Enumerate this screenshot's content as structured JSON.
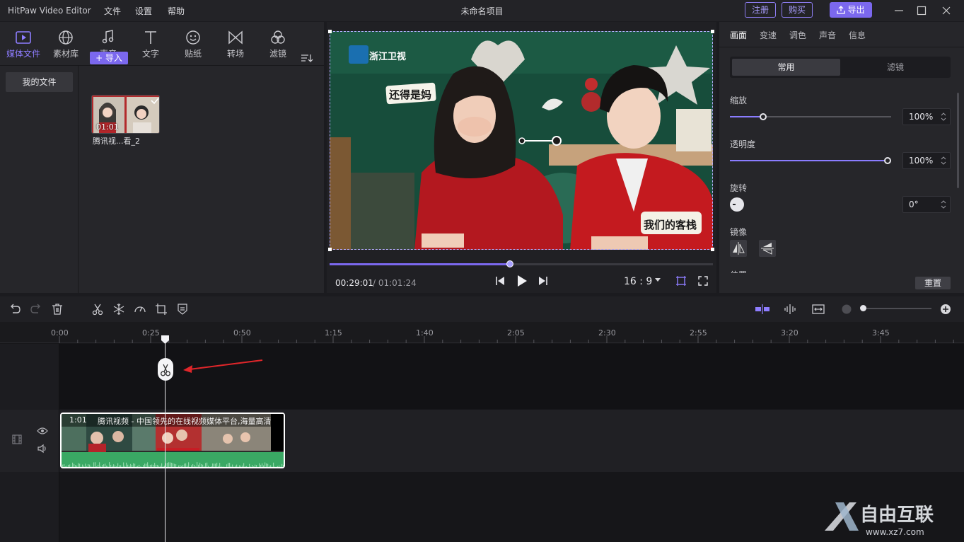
{
  "app": {
    "name": "HitPaw Video Editor",
    "menu": [
      "文件",
      "设置",
      "帮助"
    ],
    "project_title": "未命名项目",
    "register_label": "注册",
    "buy_label": "购买",
    "export_label": "导出"
  },
  "tool_tabs": [
    {
      "label": "媒体文件",
      "icon": "media-icon",
      "active": true
    },
    {
      "label": "素材库",
      "icon": "globe-icon"
    },
    {
      "label": "声音",
      "icon": "music-note-icon"
    },
    {
      "label": "文字",
      "icon": "text-icon"
    },
    {
      "label": "贴纸",
      "icon": "sticker-icon"
    },
    {
      "label": "转场",
      "icon": "transition-icon"
    },
    {
      "label": "滤镜",
      "icon": "filter-icon"
    }
  ],
  "media": {
    "sidebar_item": "我的文件",
    "import_label": "+ 导入",
    "file": {
      "duration": "01:01",
      "name": "腾讯视...看_2"
    }
  },
  "preview": {
    "time_current": "00:29:01",
    "time_total": "/ 01:01:24",
    "aspect_ratio": "16 : 9",
    "progress": 0.47,
    "overlay_texts": [
      "浙江卫视",
      "还得是妈",
      "我们的客栈"
    ]
  },
  "properties": {
    "tabs": [
      "画面",
      "变速",
      "调色",
      "声音",
      "信息"
    ],
    "active_tab": "画面",
    "segments": [
      "常用",
      "滤镜"
    ],
    "scale_label": "缩放",
    "scale_value": "100%",
    "opacity_label": "透明度",
    "opacity_value": "100%",
    "rotate_label": "旋转",
    "rotate_value": "0°",
    "mirror_label": "镜像",
    "position_label": "位置",
    "reset_label": "重置"
  },
  "timeline": {
    "ticks": [
      "0:00",
      "0:25",
      "0:50",
      "1:15",
      "1:40",
      "2:05",
      "2:30",
      "2:55",
      "3:20",
      "3:45"
    ],
    "clip": {
      "duration": "1:01",
      "title": "腾讯视频 - 中国领先的在线视频媒体平台,海量高清"
    }
  },
  "watermark": {
    "text": "自由互联",
    "url": "www.xz7.com"
  },
  "colors": {
    "accent": "#7b68ee",
    "waveform": "#3aa864"
  }
}
